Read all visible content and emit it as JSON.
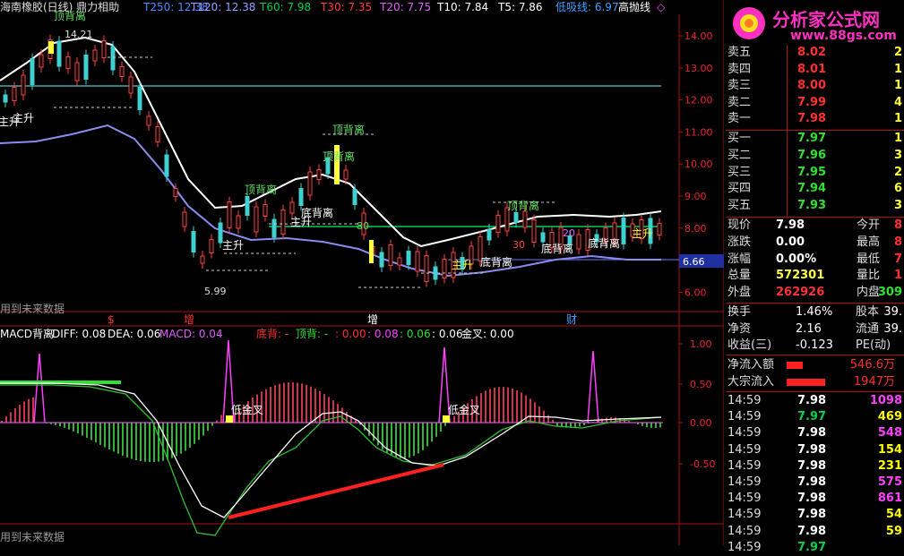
{
  "header": {
    "stock_title": "海南橡胶(日线) 鼎力相助",
    "ma_items": [
      {
        "label": "T250: 12.38",
        "color": "#4b8cff"
      },
      {
        "label": "T120: 12.38",
        "color": "#9aa0ff"
      },
      {
        "label": "T60: 7.98",
        "color": "#00d050"
      },
      {
        "label": "T30: 7.35",
        "color": "#ff3b3b"
      },
      {
        "label": "T20: 7.75",
        "color": "#e060ff"
      },
      {
        "label": "T10: 7.84",
        "color": "#ffffff"
      },
      {
        "label": "T5: 7.86",
        "color": "#ffffff"
      }
    ],
    "low_line": "低吸线: 6.97",
    "high_line": "高抛线",
    "marker": "◇"
  },
  "price_axis": {
    "ticks": [
      "14.00",
      "13.00",
      "12.00",
      "11.00",
      "10.00",
      "9.00",
      "8.00",
      "7.00",
      "6.00"
    ],
    "current_price_tag": "6.66"
  },
  "chart_annotations": {
    "top_label": "顶背离",
    "high_value": "14.21",
    "low_value": "5.99",
    "future_data_note": "用到未来数据",
    "labels": [
      "主升",
      "主升",
      "主升",
      "主升",
      "顶背离",
      "顶背离",
      "顶背离",
      "顶背离",
      "底背离",
      "底背离",
      "底背离",
      "底背离",
      "主升",
      "主升"
    ],
    "numbers": [
      "80",
      "20",
      "30"
    ],
    "bottom_markers": [
      {
        "text": "$",
        "color": "#ff3030"
      },
      {
        "text": "增",
        "color": "#ff3030"
      },
      {
        "text": "增",
        "color": "#ffffff"
      },
      {
        "text": "财",
        "color": "#40a0ff"
      }
    ]
  },
  "macd": {
    "title": "MACD背离",
    "diff": "DIFF: 0.08",
    "dea": "DEA: 0.06",
    "macd": "MACD: 0.04",
    "bottom_div": "底背: -",
    "top_div": "顶背: -",
    "val1": ": 0.00",
    "val2": ": 0.08",
    "val3": ": 0.06",
    "val4": ": 0.06",
    "gold_cross": "金叉: 0.00",
    "axis_ticks": [
      "1.00",
      "0.50",
      "0.00",
      "-0.50"
    ],
    "cross_labels": [
      "低金叉",
      "低金叉"
    ],
    "future_data_note": "用到未来数据"
  },
  "watermark": {
    "brand": "分析家公式网",
    "url": "www.88gs.com"
  },
  "order_book": {
    "asks": [
      {
        "label": "卖五",
        "price": "8.02",
        "vol": "2"
      },
      {
        "label": "卖四",
        "price": "8.01",
        "vol": "1"
      },
      {
        "label": "卖三",
        "price": "8.00",
        "vol": "1"
      },
      {
        "label": "卖二",
        "price": "7.99",
        "vol": "4"
      },
      {
        "label": "卖一",
        "price": "7.98",
        "vol": "1"
      }
    ],
    "bids": [
      {
        "label": "买一",
        "price": "7.97",
        "vol": "1"
      },
      {
        "label": "买二",
        "price": "7.96",
        "vol": "3"
      },
      {
        "label": "买三",
        "price": "7.95",
        "vol": "2"
      },
      {
        "label": "买四",
        "price": "7.94",
        "vol": "6"
      },
      {
        "label": "买五",
        "price": "7.93",
        "vol": "3"
      }
    ]
  },
  "quote": [
    {
      "l1": "现价",
      "v1": "7.98",
      "l2": "今开",
      "v2": "8"
    },
    {
      "l1": "涨跌",
      "v1": "0.00",
      "l2": "最高",
      "v2": "8"
    },
    {
      "l1": "涨幅",
      "v1": "0.00%",
      "l2": "最低",
      "v2": "7"
    },
    {
      "l1": "总量",
      "v1": "572301",
      "l2": "量比",
      "v2": "1"
    },
    {
      "l1": "外盘",
      "v1": "262926",
      "l2": "内盘",
      "v2": "309"
    }
  ],
  "quote2": [
    {
      "l1": "换手",
      "v1": "1.46%",
      "l2": "股本",
      "v2": "39."
    },
    {
      "l1": "净资",
      "v1": "2.16",
      "l2": "流通",
      "v2": "39."
    },
    {
      "l1": "收益(三)",
      "v1": "-0.123",
      "l2": "PE(动)",
      "v2": ""
    }
  ],
  "flows": [
    {
      "label": "净流入额",
      "value": "546.6万",
      "bar": 0.25
    },
    {
      "label": "大宗流入",
      "value": "1947万",
      "bar": 0.62
    }
  ],
  "ticks": [
    {
      "time": "14:59",
      "price": "7.98",
      "vol": "1098",
      "pc": "#ffffff",
      "vc": "#ff40ff"
    },
    {
      "time": "14:59",
      "price": "7.97",
      "vol": "469",
      "pc": "#00d050",
      "vc": "#ffff00"
    },
    {
      "time": "14:59",
      "price": "7.98",
      "vol": "548",
      "pc": "#ffffff",
      "vc": "#ff40ff"
    },
    {
      "time": "14:59",
      "price": "7.98",
      "vol": "154",
      "pc": "#ffffff",
      "vc": "#ffff00"
    },
    {
      "time": "14:59",
      "price": "7.98",
      "vol": "231",
      "pc": "#ffffff",
      "vc": "#ffff00"
    },
    {
      "time": "14:59",
      "price": "7.98",
      "vol": "575",
      "pc": "#ffffff",
      "vc": "#ff40ff"
    },
    {
      "time": "14:59",
      "price": "7.98",
      "vol": "861",
      "pc": "#ffffff",
      "vc": "#ff40ff"
    },
    {
      "time": "14:59",
      "price": "7.98",
      "vol": "54",
      "pc": "#ffffff",
      "vc": "#ffff00"
    },
    {
      "time": "14:59",
      "price": "7.98",
      "vol": "59",
      "pc": "#ffffff",
      "vc": "#ffff00"
    },
    {
      "time": "14:59",
      "price": "7.97",
      "vol": "",
      "pc": "#00d050",
      "vc": "#ffff00"
    }
  ]
}
